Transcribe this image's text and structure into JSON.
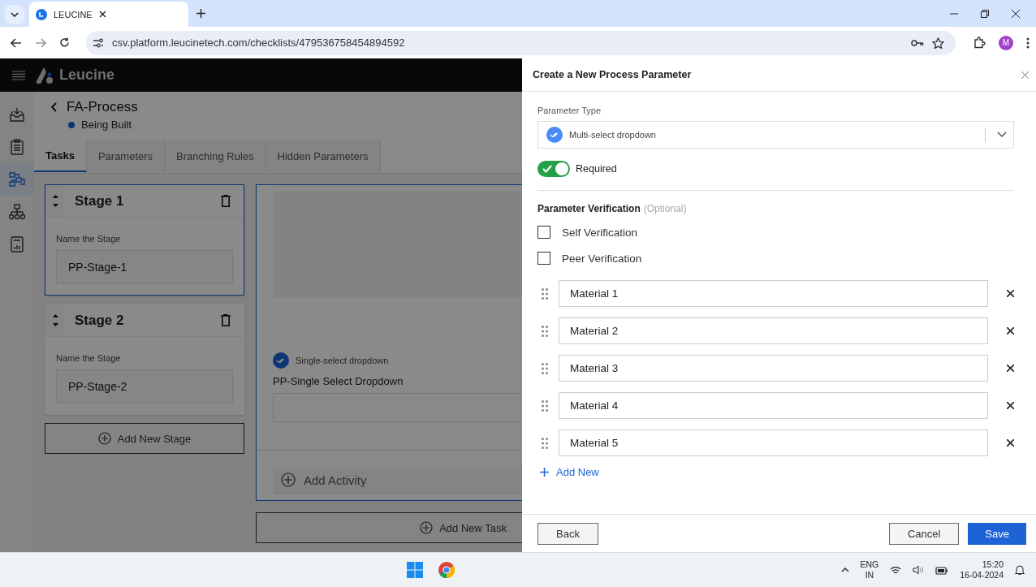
{
  "browser": {
    "tab_title": "LEUCINE",
    "url": "csv.platform.leucinetech.com/checklists/479536758454894592",
    "profile": "M"
  },
  "app": {
    "logo": "Leucine",
    "sidebar": [
      {
        "selected": false
      },
      {
        "selected": false
      },
      {
        "selected": true
      },
      {
        "selected": false
      },
      {
        "selected": false
      }
    ],
    "process": {
      "title": "FA-Process",
      "status": "Being Built"
    },
    "tabs": [
      {
        "label": "Tasks",
        "selected": true
      },
      {
        "label": "Parameters",
        "selected": false
      },
      {
        "label": "Branching Rules",
        "selected": false
      },
      {
        "label": "Hidden Parameters",
        "selected": false
      }
    ],
    "stages": [
      {
        "title": "Stage 1",
        "label": "Name the Stage",
        "value": "PP-Stage-1",
        "selected": true
      },
      {
        "title": "Stage 2",
        "label": "Name the Stage",
        "value": "PP-Stage-2",
        "selected": false
      }
    ],
    "add_stage": "Add New Stage",
    "task": {
      "parameter_type": "Single-select dropdown",
      "parameter_name": "PP-Single Select Dropdown",
      "add_activity": "Add Activity"
    },
    "add_task": "Add New Task"
  },
  "drawer": {
    "title": "Create a New Process Parameter",
    "type_label": "Parameter Type",
    "type_value": "Multi-select dropdown",
    "required": {
      "label": "Required",
      "on": true
    },
    "verification": {
      "title": "Parameter Verification",
      "note": "(Optional)",
      "options": [
        {
          "label": "Self Verification",
          "checked": false
        },
        {
          "label": "Peer Verification",
          "checked": false
        }
      ]
    },
    "options": [
      "Material 1",
      "Material 2",
      "Material 3",
      "Material 4",
      "Material 5"
    ],
    "add_new": "Add New",
    "back": "Back",
    "cancel": "Cancel",
    "save": "Save"
  },
  "taskbar": {
    "lang": "ENG",
    "region": "IN",
    "time": "15:20",
    "date": "16-04-2024"
  }
}
